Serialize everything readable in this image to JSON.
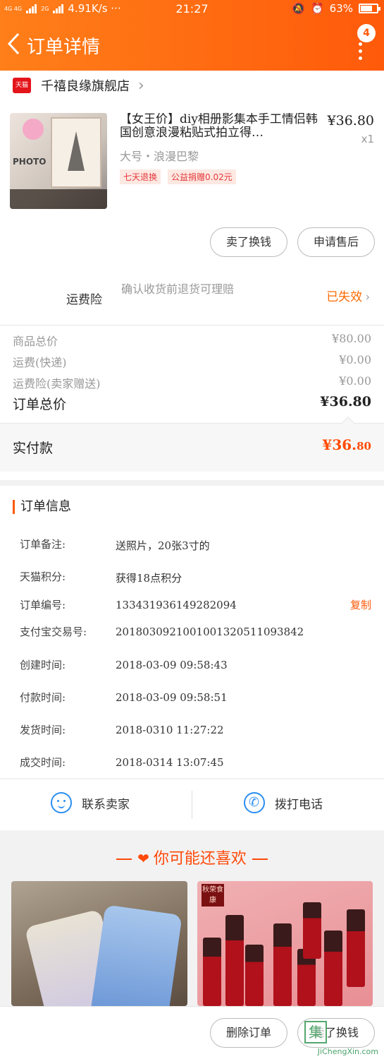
{
  "status_bar": {
    "network": "4G 4G",
    "network_small": "2G",
    "speed": "4.91K/s ···",
    "time": "21:27",
    "battery": "63%"
  },
  "nav": {
    "title": "订单详情",
    "badge": "4"
  },
  "shop": {
    "logo": "天猫",
    "name": "千禧良缘旗舰店"
  },
  "product": {
    "title": "【女王价】diy相册影集本手工情侣韩国创意浪漫粘贴式拍立得…",
    "price": "¥36.80",
    "qty": "x1",
    "spec": "大号・浪漫巴黎",
    "tags": [
      "七天退换",
      "公益捐赠0.02元"
    ],
    "image_text": "PHOTO"
  },
  "actions": {
    "sell_btn": "卖了换钱",
    "after_sale_btn": "申请售后"
  },
  "insurance": {
    "label": "运费险",
    "desc": "确认收货前退货可理赔",
    "status": "已失效"
  },
  "summary": {
    "rows": [
      {
        "label": "商品总价",
        "value": "¥80.00"
      },
      {
        "label": "运费(快递)",
        "value": "¥0.00"
      },
      {
        "label": "运费险(卖家赠送)",
        "value": "¥0.00"
      }
    ],
    "total_label": "订单总价",
    "total_value": "¥36.80",
    "paid_label": "实付款",
    "paid_int": "¥36.",
    "paid_dec": "80"
  },
  "order_info": {
    "heading": "订单信息",
    "copy_label": "复制",
    "rows": [
      {
        "key": "订单备注:",
        "value": "送照片，20张3寸的"
      },
      {
        "key": "天猫积分:",
        "value": "获得18点积分"
      },
      {
        "key": "订单编号:",
        "value": "133431936149282094"
      },
      {
        "key": "支付宝交易号:",
        "value": "2018030921001001320511093842"
      },
      {
        "key": "创建时间:",
        "value": "2018-03-09 09:58:43"
      },
      {
        "key": "付款时间:",
        "value": "2018-03-09 09:58:51"
      },
      {
        "key": "发货时间:",
        "value": "2018-0310 11:27:22"
      },
      {
        "key": "成交时间:",
        "value": "2018-0314 13:07:45"
      }
    ]
  },
  "contact": {
    "seller": "联系卖家",
    "call": "拨打电话"
  },
  "recommend": {
    "heading": "你可能还喜欢",
    "right_logo": "秋荣食康"
  },
  "bottom_bar": {
    "delete_btn": "删除订单",
    "sell_btn": "卖了换钱",
    "watermark": "JiChengXin.com",
    "watermark_char": "集"
  }
}
